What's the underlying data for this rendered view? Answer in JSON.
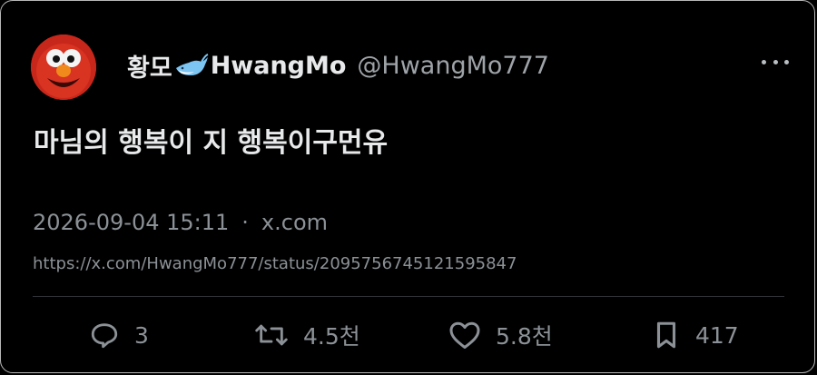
{
  "author": {
    "display_name": "황모",
    "display_name_suffix": "HwangMo",
    "handle": "@HwangMo777",
    "avatar_icon": "elmo-avatar",
    "badge_icon": "whale-icon"
  },
  "tweet": {
    "text": "마님의 행복이 지 행복이구먼유",
    "timestamp": "2026-09-04 15:11",
    "separator": "·",
    "source": "x.com",
    "url": "https://x.com/HwangMo777/status/2095756745121595847"
  },
  "actions": {
    "reply_count": "3",
    "retweet_count": "4.5천",
    "like_count": "5.8천",
    "bookmark_count": "417"
  },
  "colors": {
    "background": "#000000",
    "text": "#e7e9ea",
    "muted": "#8b9196",
    "divider": "#2f3336"
  }
}
